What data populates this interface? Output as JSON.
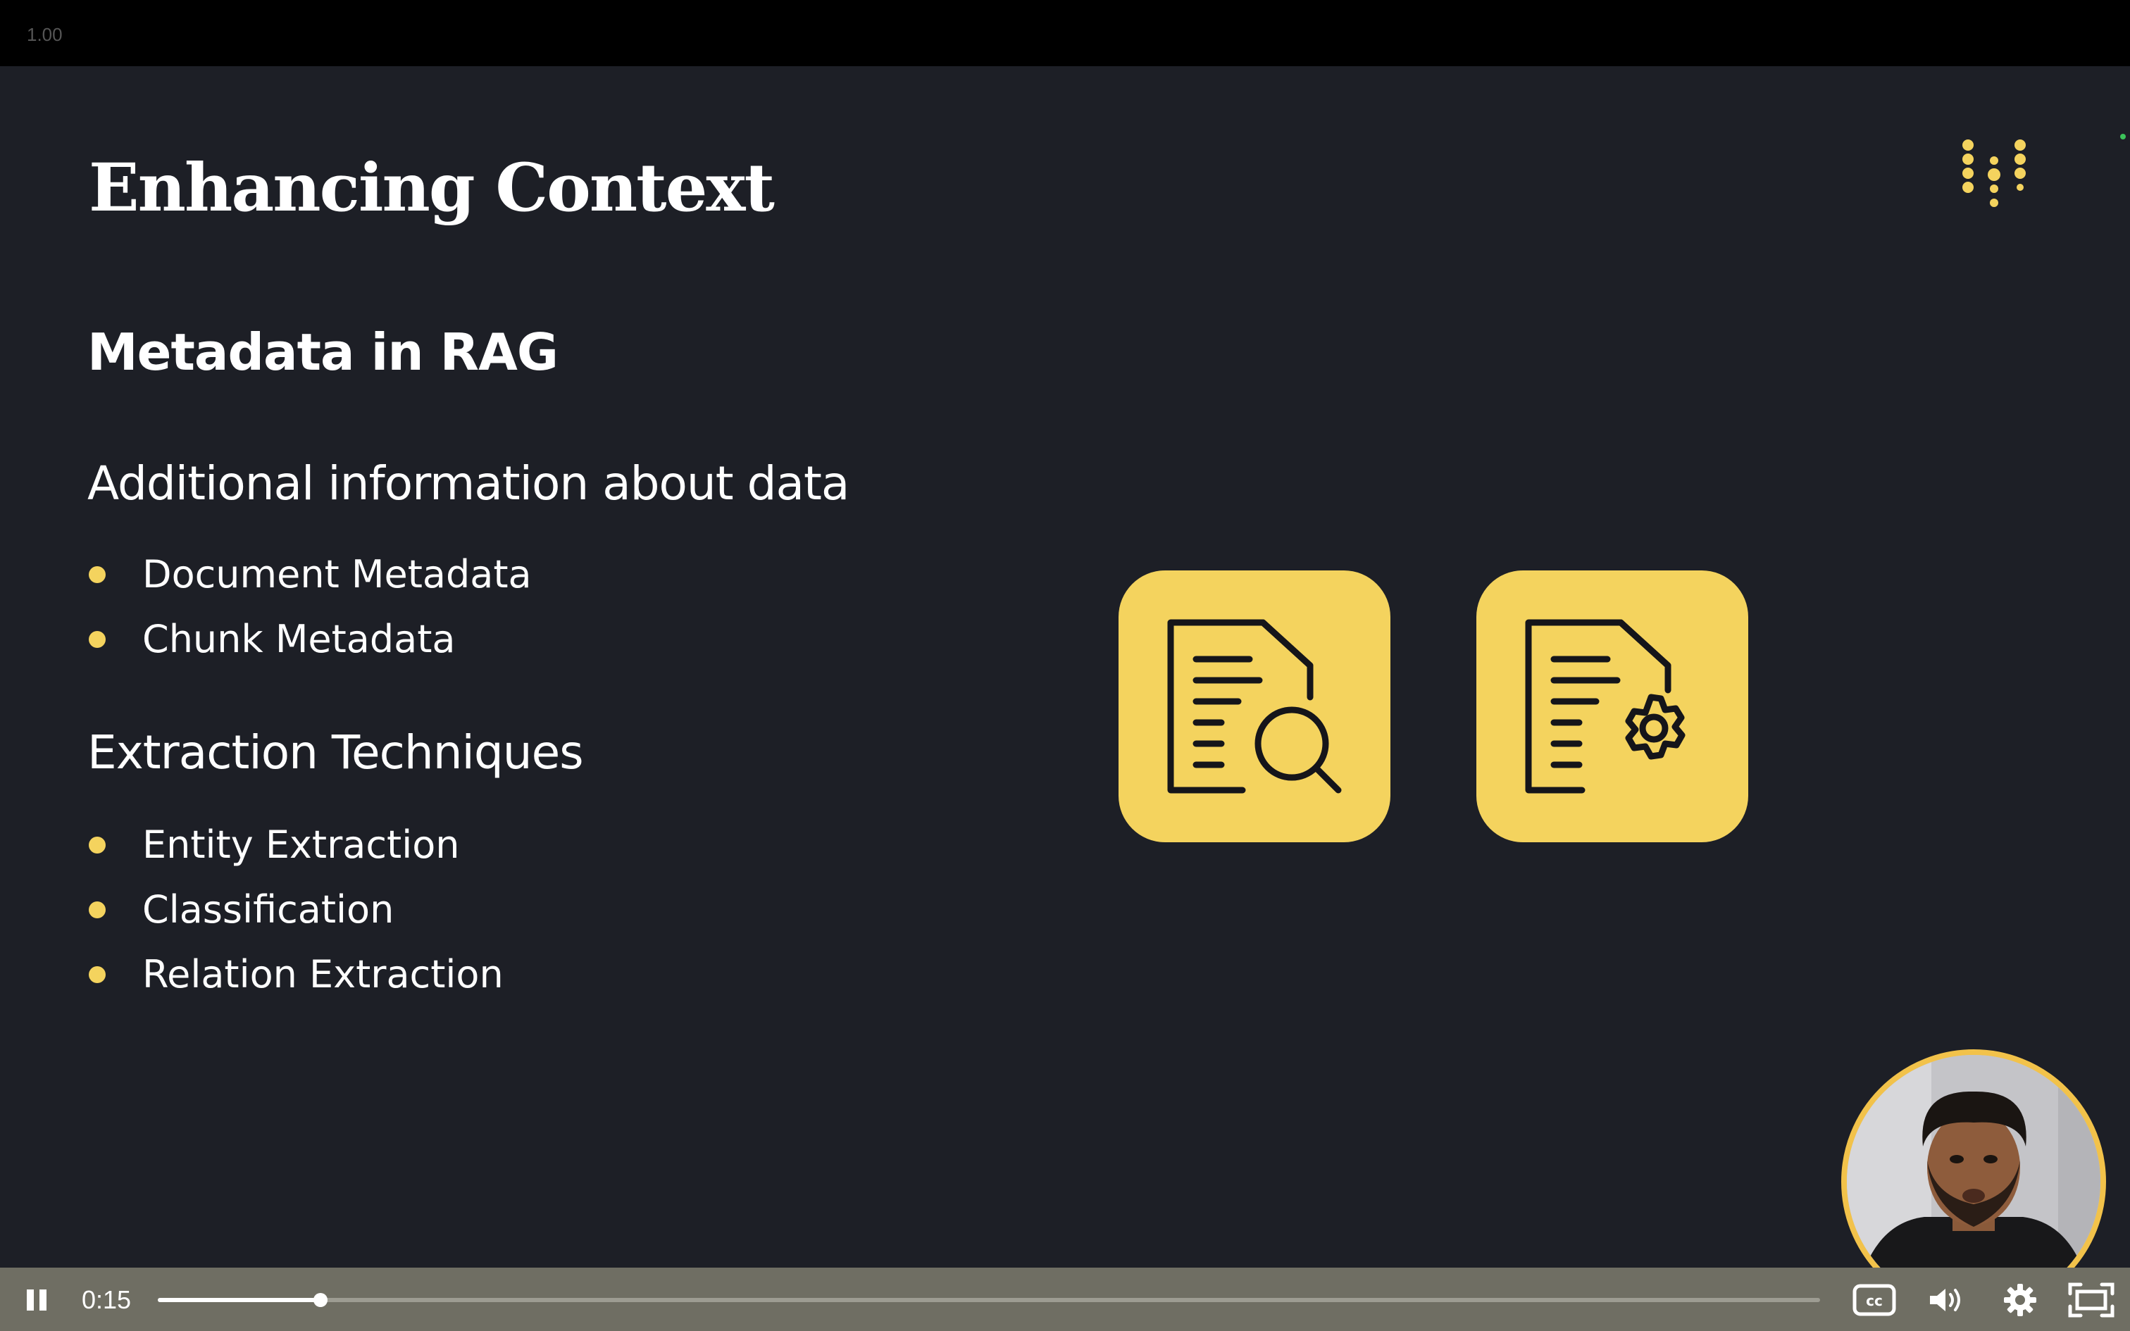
{
  "player": {
    "playback_speed": "1.00",
    "current_time": "0:15",
    "progress_fraction": 0.098,
    "accent_color": "#f4d35e"
  },
  "slide": {
    "title": "Enhancing Context",
    "subtitle": "Metadata in RAG",
    "sections": [
      {
        "heading": "Additional information about data",
        "items": [
          "Document Metadata",
          "Chunk Metadata"
        ]
      },
      {
        "heading": "Extraction Techniques",
        "items": [
          "Entity Extraction",
          "Classification",
          "Relation Extraction"
        ]
      }
    ],
    "icons": [
      "document-search-icon",
      "document-settings-icon"
    ]
  },
  "controls": {
    "icons": [
      "pause-icon",
      "closed-captions-icon",
      "volume-icon",
      "settings-icon",
      "fullscreen-icon"
    ]
  }
}
